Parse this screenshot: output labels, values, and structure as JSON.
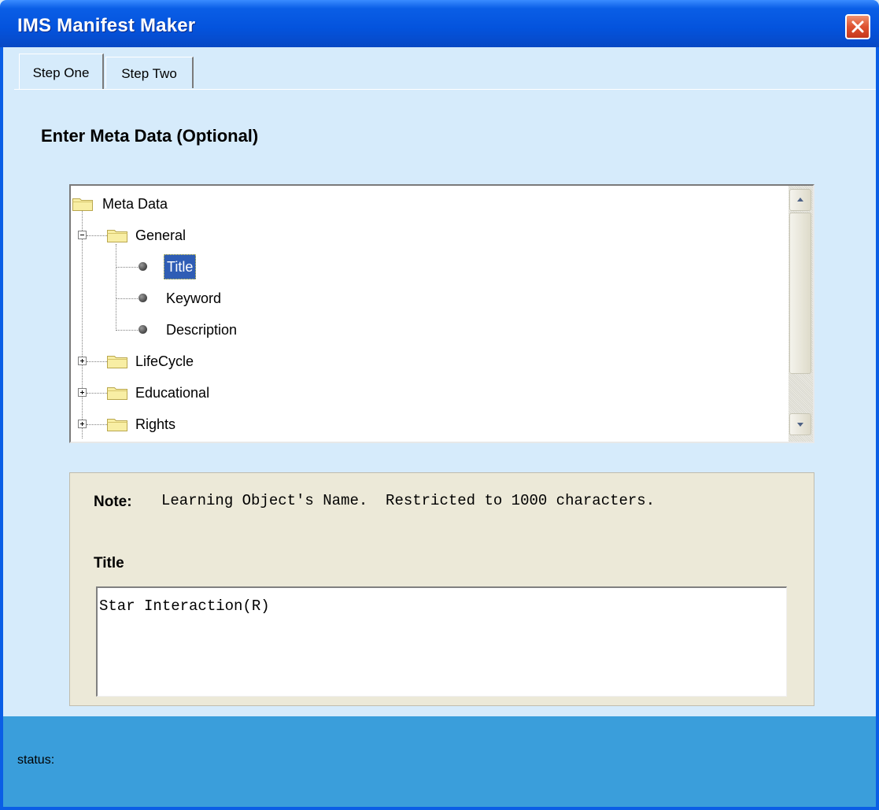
{
  "window": {
    "title": "IMS Manifest Maker"
  },
  "tabs": [
    {
      "label": "Step One",
      "selected": true
    },
    {
      "label": "Step Two",
      "selected": false
    }
  ],
  "heading": "Enter Meta Data (Optional)",
  "tree": {
    "root": "Meta Data",
    "nodes": {
      "general": "General",
      "title": "Title",
      "keyword": "Keyword",
      "description": "Description",
      "lifecycle": "LifeCycle",
      "educational": "Educational",
      "rights": "Rights"
    },
    "selected": "Title"
  },
  "detail": {
    "note_label": "Note:",
    "note_text": "Learning Object's Name.  Restricted to 1000 characters.",
    "field_label": "Title",
    "field_value": "Star Interaction(R)"
  },
  "status": {
    "text": "status:"
  },
  "colors": {
    "titlebar": "#0453dd",
    "window_bg": "#d6ebfb",
    "panel_bg": "#ece9d8",
    "statusbar": "#3a9edb",
    "selection": "#2f5db5"
  }
}
